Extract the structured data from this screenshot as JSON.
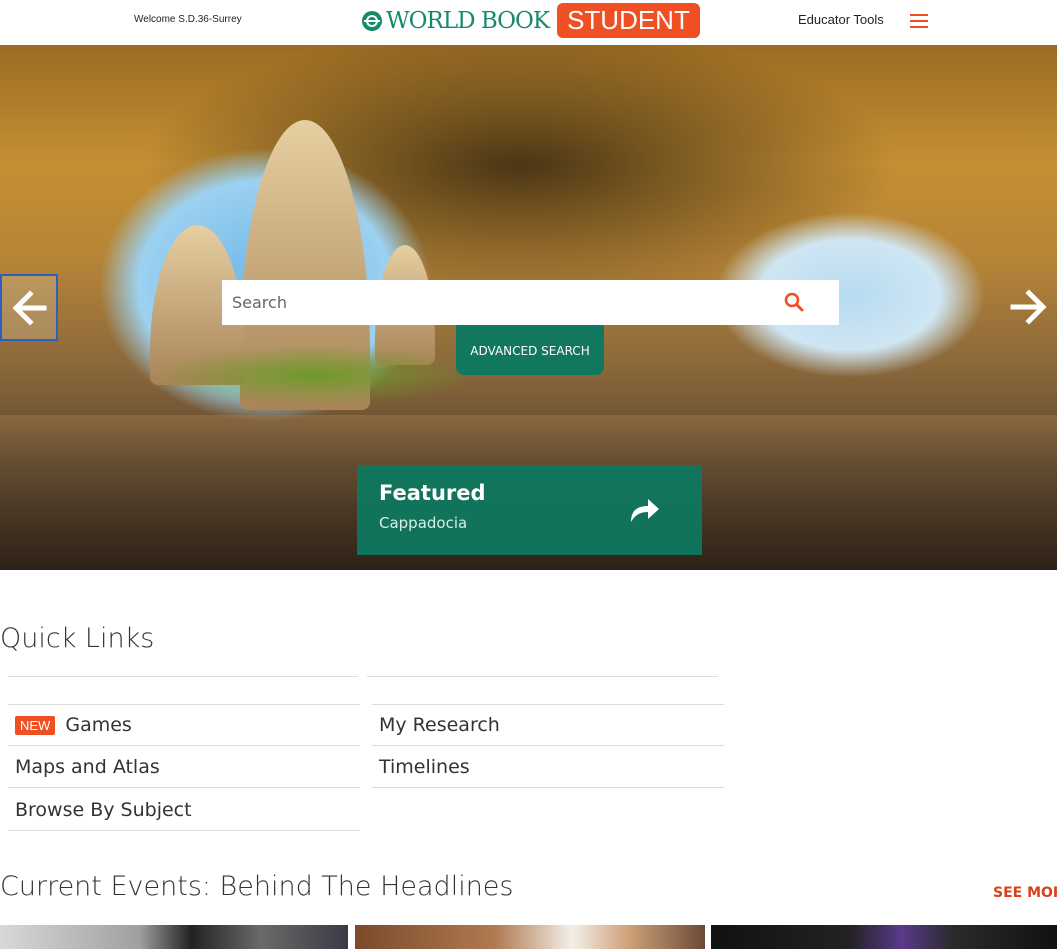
{
  "header": {
    "welcome": "Welcome S.D.36-Surrey",
    "logo_text": "WORLD BOOK",
    "logo_badge": "STUDENT",
    "educator_tools": "Educator Tools"
  },
  "hero": {
    "search_placeholder": "Search",
    "advanced_search": "ADVANCED SEARCH",
    "featured_title": "Featured",
    "featured_subtitle": "Cappadocia"
  },
  "quick_links": {
    "title": "Quick Links",
    "new_badge": "NEW",
    "left": [
      "Games",
      "Maps and Atlas",
      "Browse By Subject"
    ],
    "right": [
      "My Research",
      "Timelines"
    ]
  },
  "current_events": {
    "title": "Current Events: Behind The Headlines",
    "see_more": "SEE MORE"
  },
  "colors": {
    "brand_green": "#12775f",
    "brand_orange": "#f04e23"
  }
}
